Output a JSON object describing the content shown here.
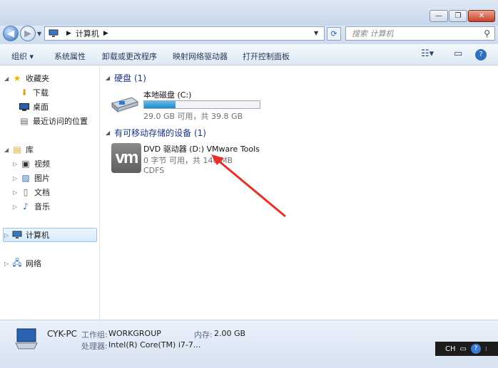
{
  "window": {
    "buttons": {
      "minimize": "—",
      "maximize": "❐",
      "close": "✕"
    }
  },
  "address": {
    "path": [
      "计算机"
    ],
    "search_placeholder": "搜索 计算机"
  },
  "toolbar": {
    "organize": "组织 ▾",
    "system_properties": "系统属性",
    "uninstall": "卸载或更改程序",
    "map_drive": "映射网络驱动器",
    "control_panel": "打开控制面板"
  },
  "sidebar": {
    "favorites": {
      "label": "收藏夹",
      "items": [
        "下载",
        "桌面",
        "最近访问的位置"
      ]
    },
    "libraries": {
      "label": "库",
      "items": [
        "视频",
        "图片",
        "文档",
        "音乐"
      ]
    },
    "computer": "计算机",
    "network": "网络"
  },
  "content": {
    "hard_disks": {
      "header": "硬盘 (1)",
      "drives": [
        {
          "name": "本地磁盘 (C:)",
          "space": "29.0 GB 可用，共 39.8 GB",
          "used_fraction": 0.27
        }
      ]
    },
    "removable": {
      "header": "有可移动存储的设备 (1)",
      "devices": [
        {
          "name": "DVD 驱动器 (D:) VMware Tools",
          "space": "0 字节 可用，共 140 MB",
          "fs": "CDFS",
          "icon_text": "vm"
        }
      ]
    }
  },
  "details": {
    "pc_name": "CYK-PC",
    "workgroup_label": "工作组:",
    "workgroup": "WORKGROUP",
    "memory_label": "内存:",
    "memory": "2.00 GB",
    "processor_label": "处理器:",
    "processor": "Intel(R) Core(TM) i7-7..."
  },
  "taskbar": {
    "lang": "CH"
  },
  "colors": {
    "accent": "#1e8bcd",
    "arrow": "#e8302a",
    "header_text": "#1e3287"
  }
}
